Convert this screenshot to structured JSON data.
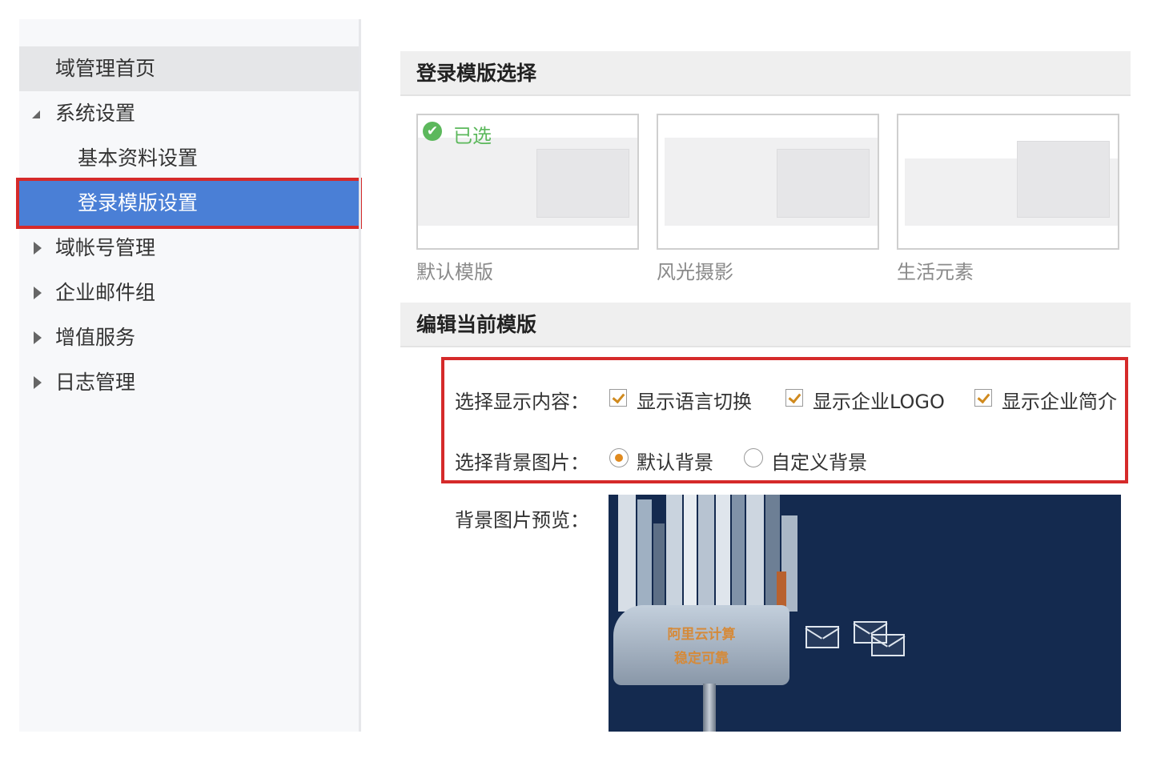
{
  "sidebar": {
    "home": "域管理首页",
    "system_settings": "系统设置",
    "basic_info": "基本资料设置",
    "login_template": "登录模版设置",
    "domain_accounts": "域帐号管理",
    "mail_groups": "企业邮件组",
    "value_added": "增值服务",
    "logs": "日志管理"
  },
  "template_section": {
    "title": "登录模版选择",
    "selected_label": "已选",
    "templates": [
      {
        "name": "默认模版",
        "selected": true
      },
      {
        "name": "风光摄影",
        "selected": false
      },
      {
        "name": "生活元素",
        "selected": false
      }
    ]
  },
  "edit_section": {
    "title": "编辑当前模版",
    "display_label": "选择显示内容：",
    "display_options": [
      {
        "label": "显示语言切换",
        "checked": true
      },
      {
        "label": "显示企业LOGO",
        "checked": true
      },
      {
        "label": "显示企业简介",
        "checked": true
      }
    ],
    "background_label": "选择背景图片：",
    "background_options": [
      {
        "label": "默认背景",
        "selected": true
      },
      {
        "label": "自定义背景",
        "selected": false
      }
    ],
    "preview_label": "背景图片预览：",
    "preview_text_line1": "阿里云计算",
    "preview_text_line2": "稳定可靠"
  },
  "colors": {
    "accent_blue": "#4a7fd6",
    "highlight_red": "#d52a2a",
    "checkmark_orange": "#d08a1e",
    "selected_green": "#5cb85c",
    "preview_bg": "#142a4f"
  }
}
